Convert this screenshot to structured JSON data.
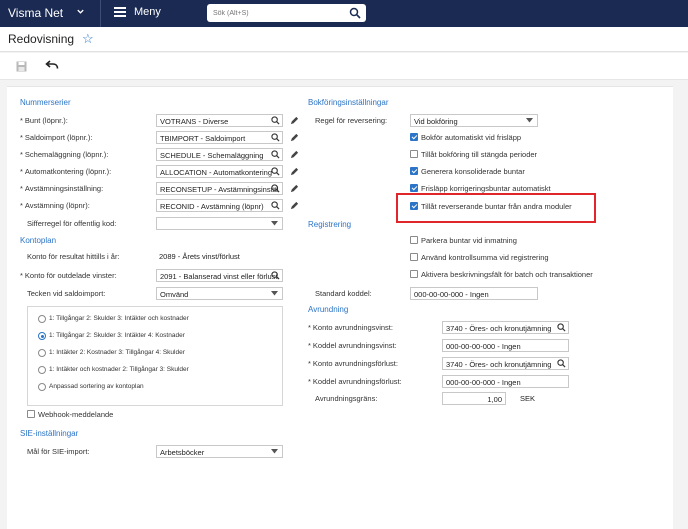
{
  "topbar": {
    "brand": "Visma Net",
    "menu_label": "Meny",
    "search_placeholder": "Sök (Alt+S)"
  },
  "header": {
    "title": "Redovisning"
  },
  "nummerserier": {
    "title": "Nummerserier",
    "rows": [
      {
        "label": "Bunt (löpnr.):",
        "value": "VOTRANS - Diverse"
      },
      {
        "label": "Saldoimport (löpnr.):",
        "value": "TBIMPORT - Saldoimport"
      },
      {
        "label": "Schemaläggning (löpnr.):",
        "value": "SCHEDULE - Schemaläggning"
      },
      {
        "label": "Automatkontering (löpnr.):",
        "value": "ALLOCATION - Automatkontering"
      },
      {
        "label": "Avstämningsinställning:",
        "value": "RECONSETUP - Avstämningsinställning"
      },
      {
        "label": "Avstämning (löpnr):",
        "value": "RECONID - Avstämning (löpnr)"
      }
    ],
    "siffer_label": "Sifferregel för offentlig kod:",
    "siffer_value": ""
  },
  "kontoplan": {
    "title": "Kontoplan",
    "resultat_label": "Konto för resultat hittills i år:",
    "resultat_value": "2089 - Årets vinst/förlust",
    "outdelade_label": "Konto för outdelade vinster:",
    "outdelade_value": "2091 - Balanserad vinst eller förlust",
    "tecken_label": "Tecken vid saldoimport:",
    "tecken_value": "Omvänd",
    "radios": [
      {
        "label": "1: Tillgångar 2: Skulder 3: Intäkter och kostnader",
        "selected": false
      },
      {
        "label": "1: Tillgångar 2: Skulder 3: Intäkter 4: Kostnader",
        "selected": true
      },
      {
        "label": "1: Intäkter 2: Kostnader 3: Tillgångar 4: Skulder",
        "selected": false
      },
      {
        "label": "1: Intäkter och kostnader 2: Tillgångar 3: Skulder",
        "selected": false
      },
      {
        "label": "Anpassad sortering av kontoplan",
        "selected": false
      }
    ],
    "webhook_label": "Webhook-meddelande"
  },
  "sie": {
    "title": "SIE-inställningar",
    "mal_label": "Mål för SIE-import:",
    "mal_value": "Arbetsböcker"
  },
  "bokforing": {
    "title": "Bokföringsinställningar",
    "regel_label": "Regel för reversering:",
    "regel_value": "Vid bokföring",
    "checks": [
      {
        "label": "Bokför automatiskt vid frisläpp",
        "checked": true
      },
      {
        "label": "Tillåt bokföring till stängda perioder",
        "checked": false
      },
      {
        "label": "Generera konsoliderade buntar",
        "checked": true
      },
      {
        "label": "Frisläpp korrigeringsbuntar automatiskt",
        "checked": true
      },
      {
        "label": "Tillåt reverserande buntar från andra moduler",
        "checked": true
      }
    ]
  },
  "registrering": {
    "title": "Registrering",
    "checks": [
      {
        "label": "Parkera buntar vid inmatning",
        "checked": false
      },
      {
        "label": "Använd kontrollsumma vid registrering",
        "checked": false
      },
      {
        "label": "Aktivera beskrivningsfält för batch och transaktioner",
        "checked": false
      }
    ],
    "koddel_label": "Standard koddel:",
    "koddel_value": "000-00-00-000 - Ingen"
  },
  "avrundning": {
    "title": "Avrundning",
    "rows": [
      {
        "label": "Konto avrundningsvinst:",
        "value": "3740 - Öres- och kronutjämning",
        "lookup": true
      },
      {
        "label": "Koddel avrundningsvinst:",
        "value": "000-00-00-000 - Ingen",
        "lookup": false
      },
      {
        "label": "Konto avrundningsförlust:",
        "value": "3740 - Öres- och kronutjämning",
        "lookup": true
      },
      {
        "label": "Koddel avrundningsförlust:",
        "value": "000-00-00-000 - Ingen",
        "lookup": false
      }
    ],
    "grans_label": "Avrundningsgräns:",
    "grans_value": "1,00",
    "currency": "SEK"
  },
  "colors": {
    "topbar": "#1a2a52",
    "accent": "#2b74c7",
    "highlight": "#e0262b"
  }
}
